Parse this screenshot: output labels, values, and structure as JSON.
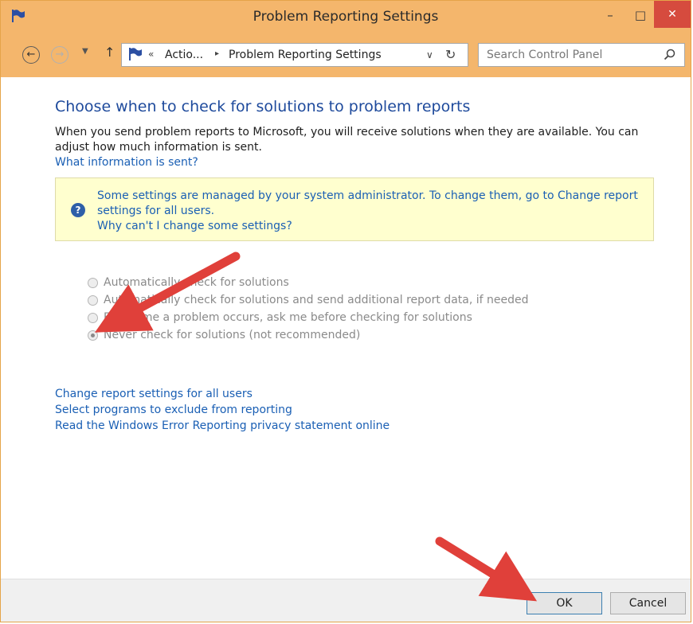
{
  "window": {
    "title": "Problem Reporting Settings",
    "minimize_glyph": "–",
    "maximize_glyph": "□",
    "close_glyph": "✕"
  },
  "nav": {
    "back_glyph": "←",
    "forward_glyph": "→",
    "dropdown_glyph": "▼",
    "up_glyph": "↑",
    "address": {
      "overflow_glyph": "«",
      "segments": [
        "Actio...",
        "Problem Reporting Settings"
      ],
      "separator_glyph": "▸",
      "dropdown_glyph": "∨",
      "refresh_glyph": "↻"
    },
    "search": {
      "placeholder": "Search Control Panel"
    }
  },
  "main": {
    "heading": "Choose when to check for solutions to problem reports",
    "description": "When you send problem reports to Microsoft, you will receive solutions when they are available. You can adjust how much information is sent.",
    "what_link": "What information is sent?",
    "notice": {
      "icon_glyph": "?",
      "text": "Some settings are managed by your system administrator. To change them, go to Change report settings for all users.",
      "link": "Why can't I change some settings?"
    },
    "options": [
      {
        "label": "Automatically check for solutions",
        "checked": false
      },
      {
        "label": "Automatically check for solutions and send additional report data, if needed",
        "checked": false
      },
      {
        "label": "Each time a problem occurs, ask me before checking for solutions",
        "checked": false
      },
      {
        "label": "Never check for solutions (not recommended)",
        "checked": true
      }
    ],
    "links": [
      "Change report settings for all users",
      "Select programs to exclude from reporting",
      "Read the Windows Error Reporting privacy statement online"
    ]
  },
  "footer": {
    "ok_label": "OK",
    "cancel_label": "Cancel"
  },
  "colors": {
    "titlebar": "#f4b66c",
    "heading": "#1e4a9c",
    "link": "#1a5fb4",
    "notice_bg": "#ffffcf",
    "close_button": "#d64b3e",
    "annotation_arrow": "#e0403a"
  }
}
